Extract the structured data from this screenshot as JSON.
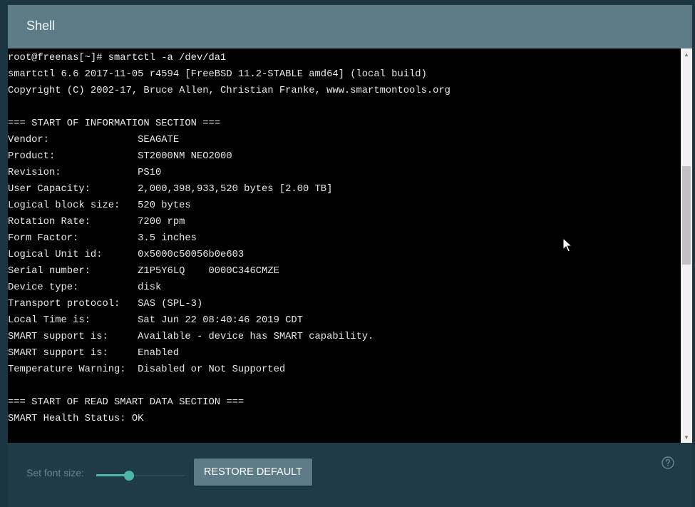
{
  "window": {
    "title": "Shell"
  },
  "terminal": {
    "lines": [
      "root@freenas[~]# smartctl -a /dev/da1",
      "smartctl 6.6 2017-11-05 r4594 [FreeBSD 11.2-STABLE amd64] (local build)",
      "Copyright (C) 2002-17, Bruce Allen, Christian Franke, www.smartmontools.org",
      "",
      "=== START OF INFORMATION SECTION ===",
      "Vendor:               SEAGATE",
      "Product:              ST2000NM NEO2000",
      "Revision:             PS10",
      "User Capacity:        2,000,398,933,520 bytes [2.00 TB]",
      "Logical block size:   520 bytes",
      "Rotation Rate:        7200 rpm",
      "Form Factor:          3.5 inches",
      "Logical Unit id:      0x5000c50056b0e603",
      "Serial number:        Z1P5Y6LQ    0000C346CMZE",
      "Device type:          disk",
      "Transport protocol:   SAS (SPL-3)",
      "Local Time is:        Sat Jun 22 08:40:46 2019 CDT",
      "SMART support is:     Available - device has SMART capability.",
      "SMART support is:     Enabled",
      "Temperature Warning:  Disabled or Not Supported",
      "",
      "=== START OF READ SMART DATA SECTION ===",
      "SMART Health Status: OK"
    ]
  },
  "footer": {
    "font_size_label": "Set font size:",
    "font_size_level": 0.37,
    "restore_label": "RESTORE DEFAULT",
    "help_icon": "help-circle-icon"
  },
  "colors": {
    "header": "#5d7c88",
    "background": "#1f3b48",
    "accent": "#4db6ac",
    "terminal_bg": "#000000",
    "terminal_fg": "#e8e8e8"
  }
}
